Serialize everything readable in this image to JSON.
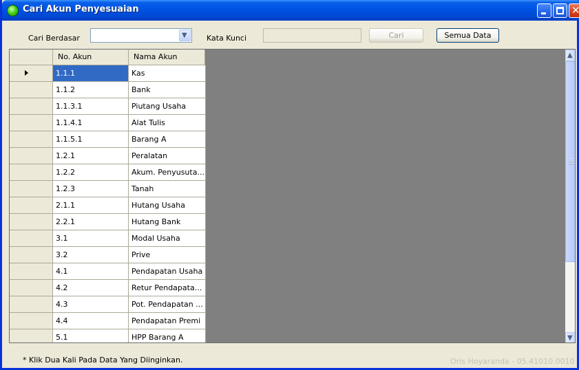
{
  "window": {
    "title": "Cari Akun Penyesuaian"
  },
  "toolbar": {
    "search_by_label": "Cari Berdasar",
    "search_by_value": "",
    "keyword_label": "Kata Kunci",
    "keyword_value": "",
    "search_button": "Cari",
    "all_data_button": "Semua Data"
  },
  "grid": {
    "columns": [
      "No. Akun",
      "Nama Akun"
    ],
    "rows": [
      {
        "no": "1.1.1",
        "nama": "Kas",
        "selected": true
      },
      {
        "no": "1.1.2",
        "nama": "Bank"
      },
      {
        "no": "1.1.3.1",
        "nama": "Piutang Usaha"
      },
      {
        "no": "1.1.4.1",
        "nama": "Alat Tulis"
      },
      {
        "no": "1.1.5.1",
        "nama": "Barang A"
      },
      {
        "no": "1.2.1",
        "nama": "Peralatan"
      },
      {
        "no": "1.2.2",
        "nama": "Akum. Penyusuta..."
      },
      {
        "no": "1.2.3",
        "nama": "Tanah"
      },
      {
        "no": "2.1.1",
        "nama": "Hutang Usaha"
      },
      {
        "no": "2.2.1",
        "nama": "Hutang Bank"
      },
      {
        "no": "3.1",
        "nama": "Modal Usaha"
      },
      {
        "no": "3.2",
        "nama": "Prive"
      },
      {
        "no": "4.1",
        "nama": "Pendapatan Usaha"
      },
      {
        "no": "4.2",
        "nama": "Retur Pendapata..."
      },
      {
        "no": "4.3",
        "nama": "Pot. Pendapatan ..."
      },
      {
        "no": "4.4",
        "nama": "Pendapatan Premi"
      },
      {
        "no": "5.1",
        "nama": "HPP Barang A"
      }
    ]
  },
  "footer": {
    "note": "* Klik Dua Kali Pada Data Yang Diinginkan.",
    "watermark": "Oris Hoyaranda - 05.41010.0010"
  },
  "colors": {
    "titlebar": "#0055e5",
    "selection": "#316ac5",
    "grid_background": "#808080",
    "window_face": "#ece9d8"
  },
  "icons": {
    "window_icon": "green-orb-icon",
    "minimize": "minimize-icon",
    "maximize": "maximize-icon",
    "close": "close-icon",
    "dropdown": "chevron-down-icon",
    "current_row": "row-pointer-icon"
  }
}
